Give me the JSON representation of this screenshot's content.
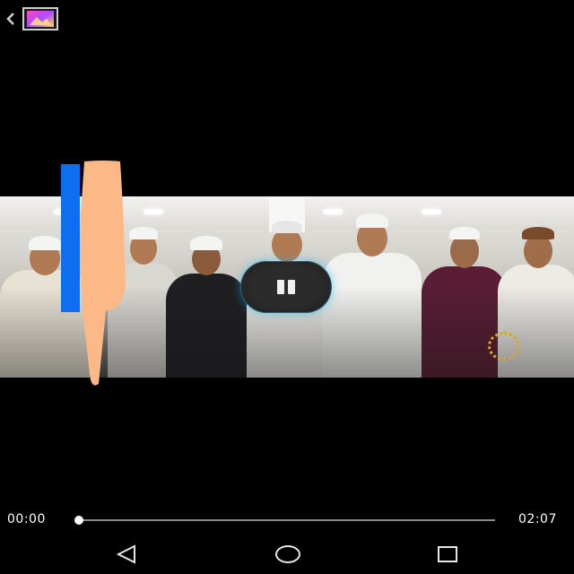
{
  "topbar": {
    "back_icon": "chevron-left-icon",
    "app_icon": "gallery-thumbnail-icon"
  },
  "player": {
    "state": "playing",
    "pause_icon": "pause-icon",
    "watermark": "broadcaster-logo",
    "accent_color": "#22c3ff"
  },
  "overlay": {
    "bar_color": "#0d6ef0",
    "finger_color": "#fcb987"
  },
  "seekbar": {
    "current_time": "00:00",
    "total_time": "02:07",
    "progress_fraction": 0.0
  },
  "navbar": {
    "back_icon": "triangle-back-icon",
    "home_icon": "circle-home-icon",
    "recents_icon": "square-recents-icon"
  }
}
